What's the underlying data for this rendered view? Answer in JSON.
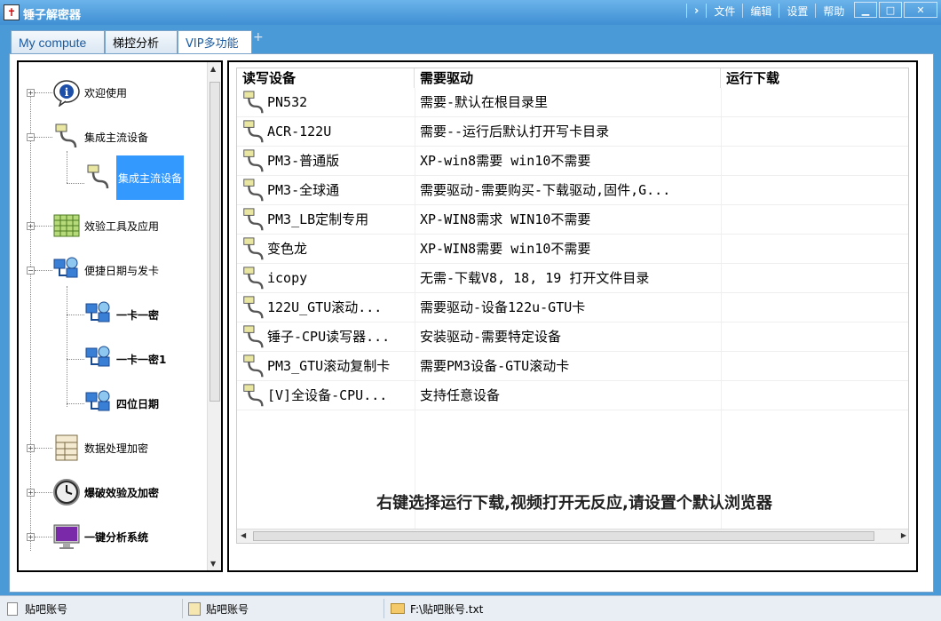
{
  "window": {
    "title": "锤子解密器"
  },
  "menu": {
    "file": "文件",
    "edit": "编辑",
    "settings": "设置",
    "help": "帮助"
  },
  "tabs": [
    {
      "label": "My compute"
    },
    {
      "label": "梯控分析"
    },
    {
      "label": "VIP多功能"
    }
  ],
  "tree": {
    "items": [
      {
        "label": "欢迎使用",
        "icon": "info-icon"
      },
      {
        "label": "集成主流设备",
        "icon": "usb-cable-icon"
      },
      {
        "label": "集成主流设备",
        "icon": "usb-cable-icon"
      },
      {
        "label": "效验工具及应用",
        "icon": "spreadsheet-icon"
      },
      {
        "label": "便捷日期与发卡",
        "icon": "network-computers-icon"
      },
      {
        "label": "一卡一密",
        "icon": "network-computers-icon"
      },
      {
        "label": "一卡一密1",
        "icon": "network-computers-icon"
      },
      {
        "label": "四位日期",
        "icon": "network-computers-icon"
      },
      {
        "label": "数据处理加密",
        "icon": "table-document-icon"
      },
      {
        "label": "爆破效验及加密",
        "icon": "clock-icon"
      },
      {
        "label": "一键分析系统",
        "icon": "monitor-icon"
      }
    ]
  },
  "list": {
    "columns": [
      "读写设备",
      "需要驱动",
      "运行下载"
    ],
    "rows": [
      {
        "device": "PN532",
        "driver": "需要-默认在根目录里"
      },
      {
        "device": "ACR-122U",
        "driver": "需要--运行后默认打开写卡目录"
      },
      {
        "device": "PM3-普通版",
        "driver": "XP-win8需要 win10不需要"
      },
      {
        "device": "PM3-全球通",
        "driver": "需要驱动-需要购买-下载驱动,固件,G..."
      },
      {
        "device": "PM3_LB定制专用",
        "driver": "XP-WIN8需求 WIN10不需要"
      },
      {
        "device": "变色龙",
        "driver": "XP-WIN8需要 win10不需要"
      },
      {
        "device": "icopy",
        "driver": "无需-下载V8, 18, 19 打开文件目录"
      },
      {
        "device": "122U_GTU滚动...",
        "driver": "需要驱动-设备122u-GTU卡"
      },
      {
        "device": "锤子-CPU读写器...",
        "driver": "安装驱动-需要特定设备"
      },
      {
        "device": "PM3_GTU滚动复制卡",
        "driver": "需要PM3设备-GTU滚动卡"
      },
      {
        "device": "[V]全设备-CPU...",
        "driver": "支持任意设备"
      }
    ],
    "hint": "右键选择运行下载,视频打开无反应,请设置个默认浏览器"
  },
  "statusbar": {
    "seg1": "贴吧账号",
    "seg2": "贴吧账号",
    "seg3": "F:\\贴吧账号.txt"
  },
  "colors": {
    "titlebar": "#3f8fd3",
    "selection": "#3399ff"
  }
}
